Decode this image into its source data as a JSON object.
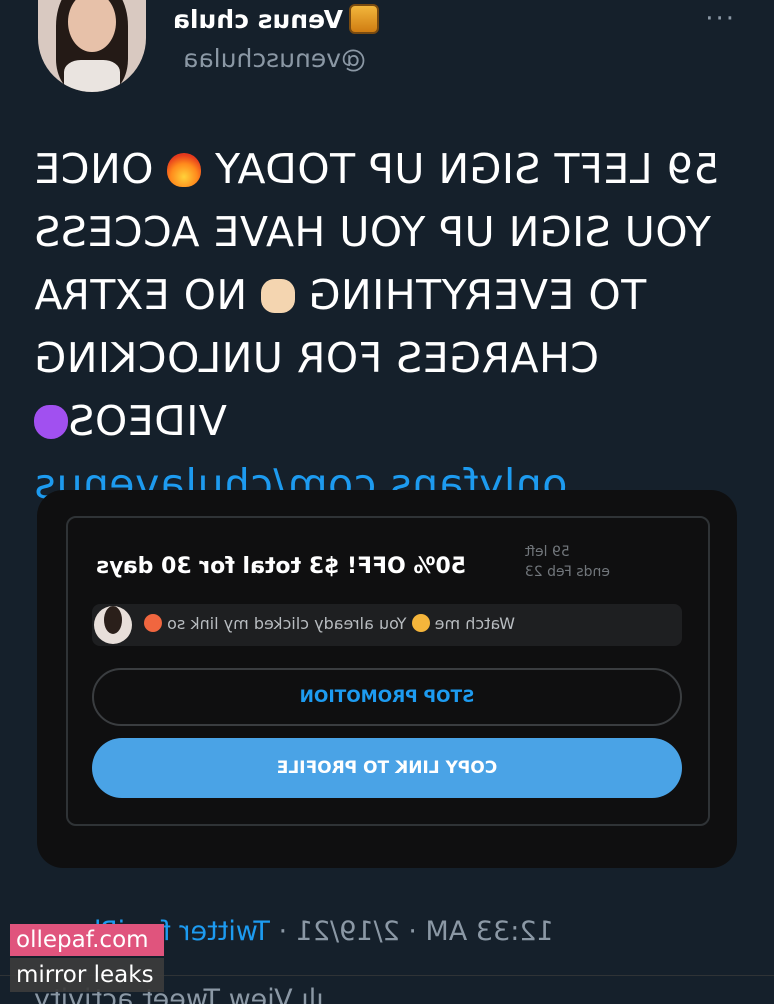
{
  "header": {
    "display_name": "Venus chula",
    "handle": "@venuschulaa",
    "more_glyph": "···"
  },
  "tweet": {
    "line1_a": "59 LEFT SIGN UP TODAY ",
    "line1_b": " ONCE",
    "line2": "YOU SIGN UP YOU HAVE ACCESS",
    "line3_a": "TO EVERYTHING ",
    "line3_b": " NO EXTRA",
    "line4": "CHARGES FOR UNLOCKING",
    "line5_a": "VIDEOS",
    "link": "onlyfans.com/chulavenus"
  },
  "card": {
    "promo_title": "50% OFF! $3 total for 30 days",
    "meta_left": "59 left",
    "meta_ends": "ends Feb 23",
    "message_a": "Watch me ",
    "message_b": " You already clicked my link so",
    "stop_button": "STOP PROMOTION",
    "copy_button": "COPY LINK TO PROFILE"
  },
  "footer": {
    "time": "12:33 AM · 2/19/21 · ",
    "source": "Twitter for iPhone",
    "activity": "ılı View Tweet activity"
  },
  "watermark": {
    "line1": "ollepaf.com",
    "line2": "mirror leaks"
  },
  "colors": {
    "background": "#15202b",
    "link": "#1d9bf0",
    "copy_button": "#4aa3e6",
    "watermark_pink": "#e0547d"
  },
  "icons": [
    "honey-pot-icon",
    "fire-icon",
    "raising-hands-icon",
    "purple-heart-icon",
    "more-icon"
  ]
}
